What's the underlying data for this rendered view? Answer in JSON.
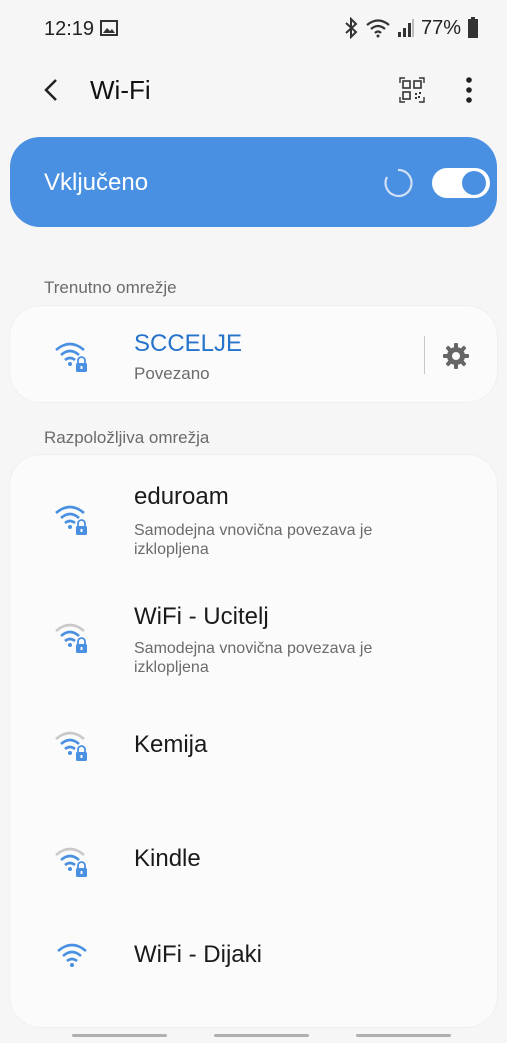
{
  "status_bar": {
    "time": "12:19",
    "battery": "77%",
    "icons": [
      "gallery-icon",
      "bluetooth-icon",
      "wifi-status-icon",
      "signal-icon",
      "battery-icon"
    ]
  },
  "header": {
    "title": "Wi-Fi",
    "icons": [
      "back-icon",
      "qr-code-icon",
      "more-vert-icon"
    ]
  },
  "master": {
    "label": "Vključeno",
    "enabled": true,
    "accent": "#4a90e2"
  },
  "current": {
    "section_label": "Trenutno omrežje",
    "name": "SCCELJE",
    "status": "Povezano",
    "name_color": "#2673cc"
  },
  "available": {
    "section_label": "Razpoložljiva omrežja",
    "networks": [
      {
        "name": "eduroam",
        "sub_line1": "Samodejna vnovična povezava je",
        "sub_line2": "izklopljena",
        "secured": true,
        "signal": "strong"
      },
      {
        "name": "WiFi - Ucitelj",
        "sub_line1": "Samodejna vnovična povezava je",
        "sub_line2": "izklopljena",
        "secured": true,
        "signal": "medium"
      },
      {
        "name": "Kemija",
        "secured": true,
        "signal": "medium"
      },
      {
        "name": "Kindle",
        "secured": true,
        "signal": "medium"
      },
      {
        "name": "WiFi - Dijaki",
        "secured": false,
        "signal": "strong"
      }
    ]
  }
}
